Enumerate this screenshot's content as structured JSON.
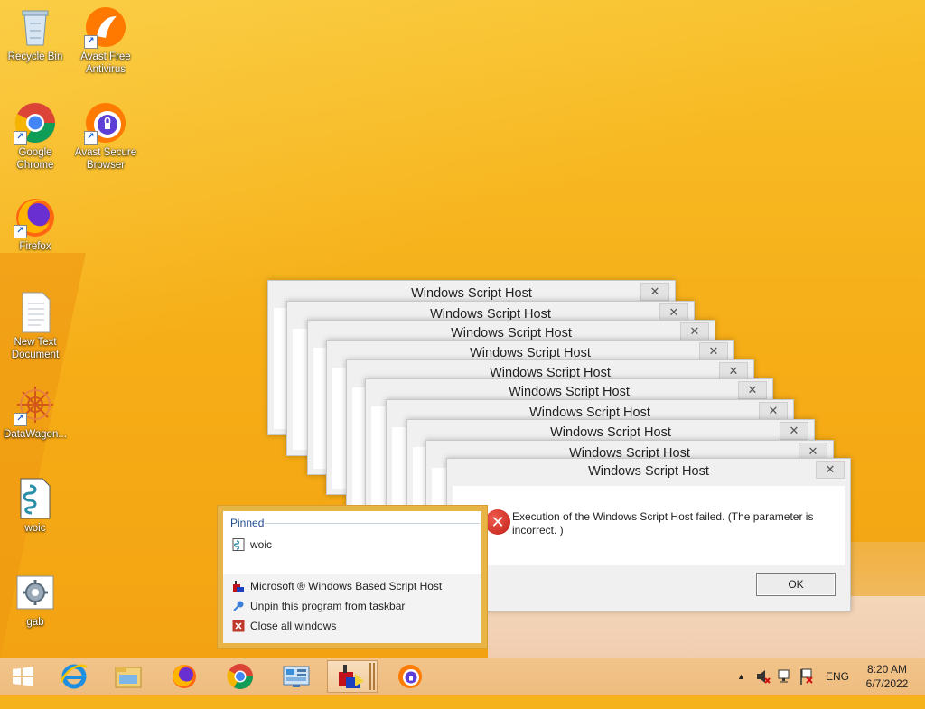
{
  "desktop": {
    "icons": [
      {
        "label": "Recycle Bin"
      },
      {
        "label": "Avast Free Antivirus"
      },
      {
        "label": "Google Chrome"
      },
      {
        "label": "Avast Secure Browser"
      },
      {
        "label": "Firefox"
      },
      {
        "label": "New Text Document"
      },
      {
        "label": "DataWagon..."
      },
      {
        "label": "woic"
      },
      {
        "label": "gab"
      }
    ]
  },
  "dialogs": {
    "title": "Windows Script Host",
    "close_glyph": "✕",
    "message": "Execution of the Windows Script Host failed. (The parameter is incorrect. )",
    "ok_label": "OK"
  },
  "jumplist": {
    "pinned_header": "Pinned",
    "pinned_item": "woic",
    "app_item": "Microsoft ® Windows Based Script Host",
    "unpin_item": "Unpin this program from taskbar",
    "close_item": "Close all windows"
  },
  "taskbar": {
    "language": "ENG",
    "time": "8:20 AM",
    "date": "6/7/2022"
  }
}
